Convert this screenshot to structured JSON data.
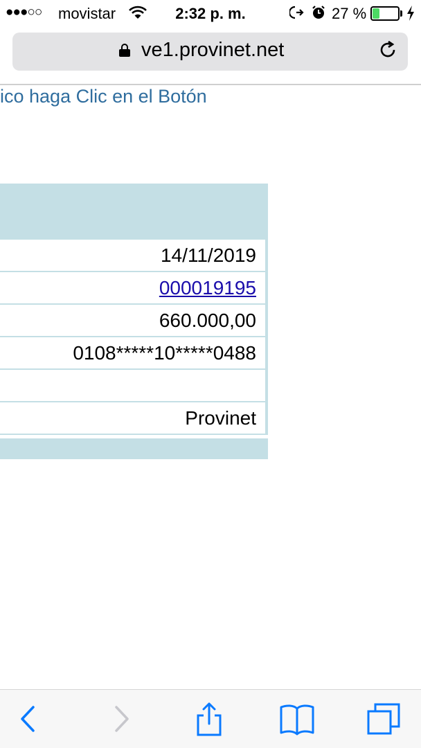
{
  "status_bar": {
    "signal": "●●●○○",
    "carrier": "movistar",
    "time": "2:32 p. m.",
    "battery_percent": "27 %",
    "battery_level": 0.27,
    "wifi_icon": "wifi-icon",
    "battery_color": "#4cd964"
  },
  "address_bar": {
    "url": "ve1.provinet.net"
  },
  "page": {
    "instruction_text": "ico haga Clic en el Botón",
    "link_color": "#2f6d9e",
    "header_color": "#c4dfe5",
    "rows": [
      {
        "value": "14/11/2019",
        "is_link": false
      },
      {
        "value": "000019195",
        "is_link": true
      },
      {
        "value": "660.000,00",
        "is_link": false
      },
      {
        "value": "0108*****10*****0488",
        "is_link": false
      },
      {
        "value": "",
        "is_link": false
      },
      {
        "value": "Provinet",
        "is_link": false
      }
    ]
  },
  "toolbar": {
    "items": [
      "back-icon",
      "forward-icon",
      "share-icon",
      "bookmarks-icon",
      "tabs-icon"
    ],
    "accent": "#0a7aff"
  }
}
